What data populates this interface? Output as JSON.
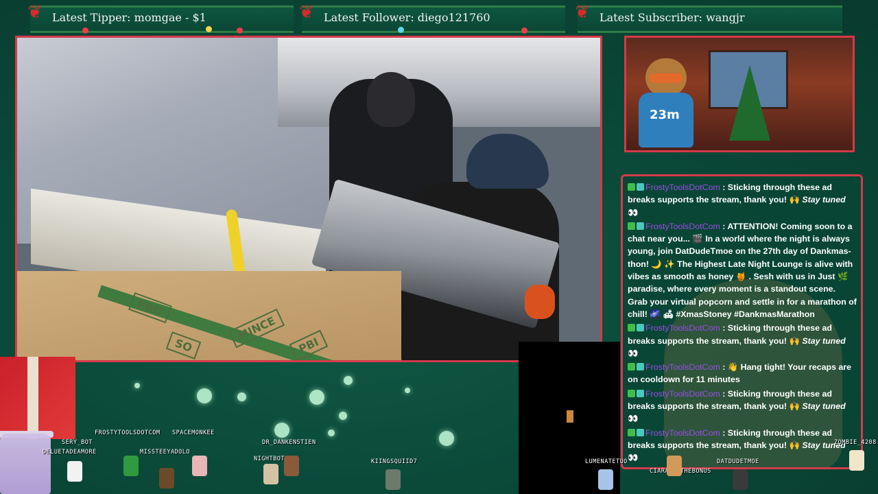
{
  "tickers": {
    "tipper": "Latest Tipper: momgae - $1",
    "follower": "Latest Follower: diego121760",
    "subscriber": "Latest Subscriber: wangjr"
  },
  "video": {
    "box_labels": [
      "PBO",
      "SO",
      "MINCE",
      "PBI"
    ]
  },
  "webcam": {
    "timer": "23m"
  },
  "chat": {
    "messages": [
      {
        "user": "FrostyToolsDotCom",
        "text": " : Sticking through these ad breaks supports the stream, thank you! 🙌 ",
        "em": "Stay tuned",
        "tail": " 👀"
      },
      {
        "user": "FrostyToolsDotCom",
        "text": " : ATTENTION! Coming soon to a chat near you... 🎬 In a world where the night is always young, join DatDudeTmoe on the 27th day of Dankmas-thon! 🌙 ✨ The Highest Late Night Lounge is alive with vibes as smooth as honey 🍯 . Sesh with us in Just 🌿 paradise, where every moment is a standout scene. Grab your virtual popcorn and settle in for a marathon of chill! 🌌 🛋 #XmasStoney #DankmasMarathon",
        "em": "",
        "tail": ""
      },
      {
        "user": "FrostyToolsDotCom",
        "text": " : Sticking through these ad breaks supports the stream, thank you! 🙌 ",
        "em": "Stay tuned",
        "tail": " 👀"
      },
      {
        "user": "FrostyToolsDotCom",
        "text": " : 👋 Hang tight! Your recaps are on cooldown for 11 minutes",
        "em": "",
        "tail": ""
      },
      {
        "user": "FrostyToolsDotCom",
        "text": " : Sticking through these ad breaks supports the stream, thank you! 🙌 ",
        "em": "Stay tuned",
        "tail": " 👀"
      },
      {
        "user": "FrostyToolsDotCom",
        "text": " : Sticking through these ad breaks supports the stream, thank you! 🙌 ",
        "em": "Stay tuned",
        "tail": " 👀"
      }
    ]
  },
  "viewers": [
    {
      "name": "SERY_BOT"
    },
    {
      "name": "DELUETADEAMORE"
    },
    {
      "name": "FROSTYTOOLSDOTCOM"
    },
    {
      "name": "SPACEMONKEE"
    },
    {
      "name": "MISSTEEYADOLO"
    },
    {
      "name": "DR_DANKENSTIEN"
    },
    {
      "name": "NIGHTBOT"
    },
    {
      "name": "KIINGSQUIID7"
    },
    {
      "name": "LUMENATETUO"
    },
    {
      "name": "CIARAPINTHEBONUS"
    },
    {
      "name": "DATDUDETMOE"
    },
    {
      "name": "ZOMBIE_4208"
    }
  ],
  "colors": {
    "frame_border": "#d43a4a",
    "background": "#0b4a39",
    "username": "#9a4de8"
  }
}
